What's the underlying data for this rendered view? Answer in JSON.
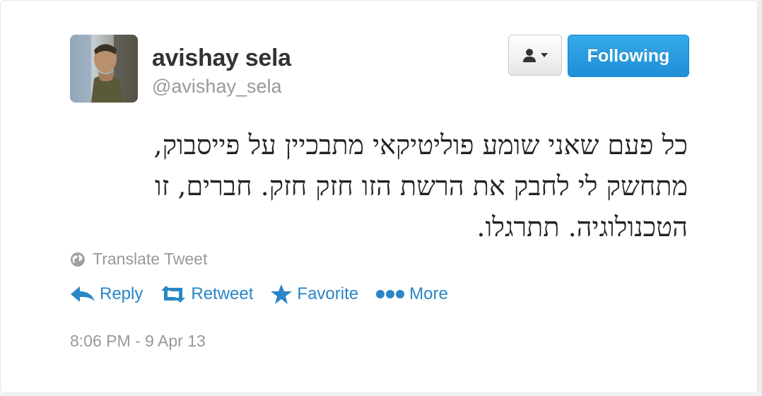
{
  "user": {
    "display_name": "avishay sela",
    "screen_name": "@avishay_sela"
  },
  "buttons": {
    "user_menu_icon": "person-dropdown-icon",
    "following_label": "Following"
  },
  "tweet": {
    "lines": [
      "כל פעם שאני שומע פוליטיקאי מתבכיין על פייסבוק,",
      "מתחשק לי לחבק את הרשת הזו חזק חזק. חברים, זו",
      "הטכנולוגיה. תתרגלו."
    ],
    "translate_label": "Translate Tweet",
    "timestamp": "8:06 PM - 9 Apr 13"
  },
  "actions": {
    "reply": "Reply",
    "retweet": "Retweet",
    "favorite": "Favorite",
    "more": "More"
  },
  "colors": {
    "link": "#2a86c7",
    "following_bg": "#1f8fd6",
    "muted": "#999999"
  }
}
